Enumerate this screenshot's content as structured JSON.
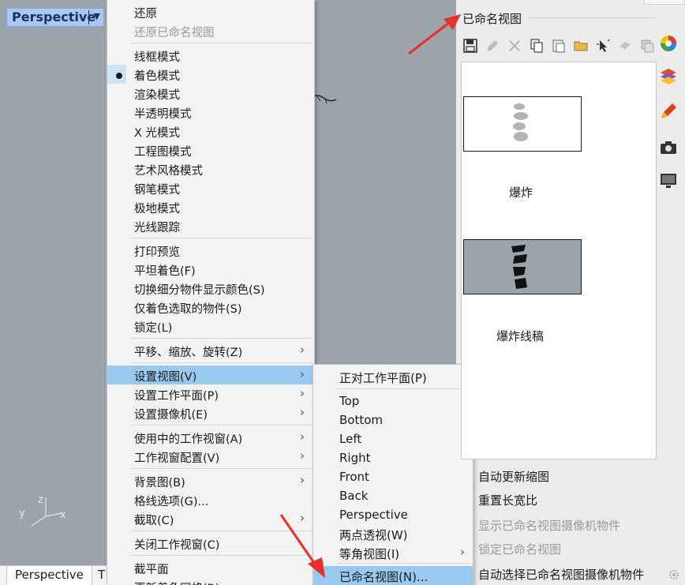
{
  "viewport": {
    "title": "Perspective",
    "dropdown_arrow": "▼",
    "axis_labels": {
      "z": "z",
      "y": "y",
      "x": "x"
    }
  },
  "bottom_tabs": {
    "active": "Perspective",
    "next": "T"
  },
  "context_menu": {
    "items": [
      {
        "label": "还原",
        "disabled": false
      },
      {
        "label": "还原已命名视图",
        "disabled": true
      },
      {
        "label": "线框模式"
      },
      {
        "label": "着色模式",
        "checked": true
      },
      {
        "label": "渲染模式"
      },
      {
        "label": "半透明模式"
      },
      {
        "label": "X 光模式"
      },
      {
        "label": "工程图模式"
      },
      {
        "label": "艺术风格模式"
      },
      {
        "label": "钢笔模式"
      },
      {
        "label": "极地模式"
      },
      {
        "label": "光线跟踪"
      },
      {
        "label": "打印预览"
      },
      {
        "label": "平坦着色(F)"
      },
      {
        "label": "切换细分物件显示颜色(S)"
      },
      {
        "label": "仅着色选取的物件(S)"
      },
      {
        "label": "锁定(L)"
      },
      {
        "label": "平移、缩放、旋转(Z)",
        "submenu": true
      },
      {
        "label": "设置视图(V)",
        "submenu": true,
        "highlighted": true
      },
      {
        "label": "设置工作平面(P)",
        "submenu": true
      },
      {
        "label": "设置摄像机(E)",
        "submenu": true
      },
      {
        "label": "使用中的工作视窗(A)",
        "submenu": true
      },
      {
        "label": "工作视窗配置(V)",
        "submenu": true
      },
      {
        "label": "背景图(B)",
        "submenu": true
      },
      {
        "label": "格线选项(G)..."
      },
      {
        "label": "截取(C)",
        "submenu": true
      },
      {
        "label": "关闭工作视窗(C)"
      },
      {
        "label": "截平面"
      },
      {
        "label": "更新着色网格(R)"
      }
    ],
    "submenu_arrow": "›"
  },
  "set_view_submenu": {
    "items": [
      {
        "label": "正对工作平面(P)"
      },
      {
        "label": "Top"
      },
      {
        "label": "Bottom"
      },
      {
        "label": "Left"
      },
      {
        "label": "Right"
      },
      {
        "label": "Front"
      },
      {
        "label": "Back"
      },
      {
        "label": "Perspective"
      },
      {
        "label": "两点透视(W)"
      },
      {
        "label": "等角视图(I)",
        "submenu": true
      },
      {
        "label": "已命名视图(N)...",
        "highlighted": true
      }
    ]
  },
  "named_views_panel": {
    "title": "已命名视图",
    "toolbar_icons": [
      "save-icon",
      "edit-icon",
      "delete-icon",
      "copy-icon",
      "paste-icon",
      "open-folder-icon",
      "select-icon",
      "restore-icon",
      "window-icon"
    ],
    "views": [
      {
        "name": "爆炸"
      },
      {
        "name": "爆炸线稿"
      }
    ],
    "options": [
      {
        "label": "自动更新缩图",
        "disabled": false
      },
      {
        "label": "重置长宽比",
        "disabled": false
      },
      {
        "label": "显示已命名视图摄像机物件",
        "disabled": true
      },
      {
        "label": "锁定已命名视图",
        "disabled": true
      },
      {
        "label": "自动选择已命名视图摄像机物件",
        "disabled": false
      }
    ]
  },
  "side_icons": [
    "color-wheel-icon",
    "layers-icon",
    "brush-icon",
    "camera-icon",
    "monitor-icon"
  ],
  "colors": {
    "viewport_bg": "#9ba3ab",
    "menu_bg": "#f3f3f3",
    "highlight": "#99c9ef",
    "annotation_arrow": "#e8302a",
    "title_bg": "#a9c8f0"
  }
}
